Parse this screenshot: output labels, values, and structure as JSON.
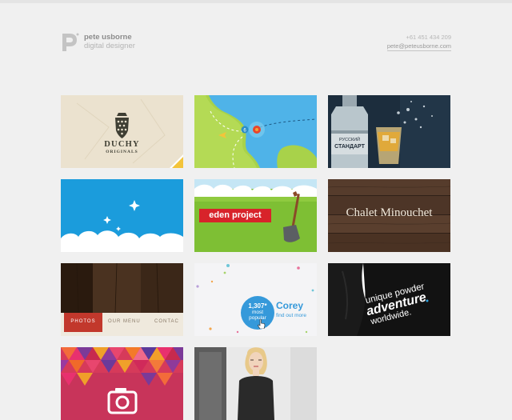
{
  "header": {
    "logo_icon": "p-monogram-icon",
    "name": "pete usborne",
    "role": "digital designer",
    "phone": "+61 451 434 209",
    "email": "pete@peteusborne.com"
  },
  "portfolio": {
    "tiles": [
      {
        "id": "duchy",
        "title": "DUCHY",
        "subtitle": "ORIGINALS",
        "icon": "crest-icon"
      },
      {
        "id": "map",
        "icon": "map-pin-icon",
        "marker": "6"
      },
      {
        "id": "vodka",
        "bottle_label_1": "РУССКИЙ",
        "bottle_label_2": "СТАНДАРТ"
      },
      {
        "id": "sky",
        "icon": "sparkle-icon"
      },
      {
        "id": "eden",
        "label": "eden project",
        "icon": "spade-icon"
      },
      {
        "id": "chalet",
        "label": "Chalet Minouchet"
      },
      {
        "id": "wood-menu",
        "photos": "PHOTOS",
        "our_menu": "OUR MENU",
        "contact": "CONTAC"
      },
      {
        "id": "corey",
        "count": "1,307*",
        "most": "most",
        "popular": "popular",
        "name": "Corey",
        "find_out_more": "find out more",
        "icon": "hand-cursor-icon"
      },
      {
        "id": "hoodie",
        "line1": "unique powder",
        "line2": "adventure",
        "line3": "worldwide."
      },
      {
        "id": "pattern",
        "icon": "camera-icon"
      },
      {
        "id": "model"
      }
    ]
  },
  "colors": {
    "background": "#f0f0f0",
    "text_dark": "#8c8c8c",
    "text_light": "#b4b4b4",
    "eden_red": "#d8232a",
    "corey_blue": "#3599da"
  }
}
